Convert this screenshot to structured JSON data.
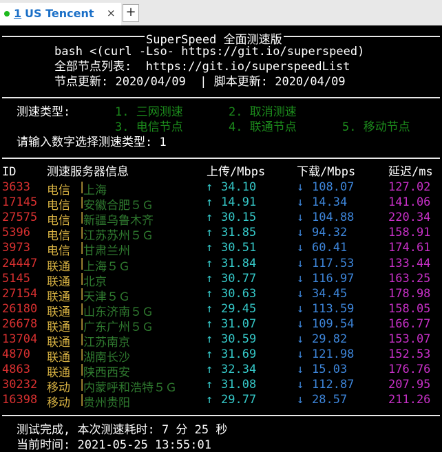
{
  "tab": {
    "number": "1",
    "title": "US Tencent",
    "close": "×",
    "new_tab": "+"
  },
  "header": {
    "title": "SuperSpeed 全面测速版",
    "line1": "bash <(curl -Lso- https://git.io/superspeed)",
    "line2": "全部节点列表:  https://git.io/superspeedList",
    "line3": "节点更新: 2020/04/09  | 脚本更新: 2020/04/09"
  },
  "menu": {
    "label": "测速类型:",
    "opt1": "1. 三网测速",
    "opt2": "2. 取消测速",
    "opt3": "3. 电信节点",
    "opt4": "4. 联通节点",
    "opt5": "5. 移动节点",
    "prompt": "请输入数字选择测速类型: 1"
  },
  "table": {
    "headers": {
      "id": "ID",
      "info": "测速服务器信息",
      "up": "上传/Mbps",
      "down": "下载/Mbps",
      "lat": "延迟/ms"
    },
    "rows": [
      {
        "id": "3633",
        "isp": "电信",
        "loc": "上海",
        "up": "34.10",
        "down": "108.07",
        "lat": "127.02"
      },
      {
        "id": "17145",
        "isp": "电信",
        "loc": "安徽合肥５Ｇ",
        "up": "14.91",
        "down": "14.34",
        "lat": "141.06"
      },
      {
        "id": "27575",
        "isp": "电信",
        "loc": "新疆乌鲁木齐",
        "up": "30.15",
        "down": "104.88",
        "lat": "220.34"
      },
      {
        "id": "5396",
        "isp": "电信",
        "loc": "江苏苏州５Ｇ",
        "up": "31.85",
        "down": "94.32",
        "lat": "158.91"
      },
      {
        "id": "3973",
        "isp": "电信",
        "loc": "甘肃兰州",
        "up": "30.51",
        "down": "60.41",
        "lat": "174.61"
      },
      {
        "id": "24447",
        "isp": "联通",
        "loc": "上海５Ｇ",
        "up": "31.84",
        "down": "117.53",
        "lat": "133.44"
      },
      {
        "id": "5145",
        "isp": "联通",
        "loc": "北京",
        "up": "30.77",
        "down": "116.97",
        "lat": "163.25"
      },
      {
        "id": "27154",
        "isp": "联通",
        "loc": "天津５Ｇ",
        "up": "30.63",
        "down": "34.45",
        "lat": "178.98"
      },
      {
        "id": "26180",
        "isp": "联通",
        "loc": "山东济南５Ｇ",
        "up": "29.45",
        "down": "113.59",
        "lat": "158.05"
      },
      {
        "id": "26678",
        "isp": "联通",
        "loc": "广东广州５Ｇ",
        "up": "31.07",
        "down": "109.54",
        "lat": "166.77"
      },
      {
        "id": "13704",
        "isp": "联通",
        "loc": "江苏南京",
        "up": "30.59",
        "down": "29.82",
        "lat": "153.07"
      },
      {
        "id": "4870",
        "isp": "联通",
        "loc": "湖南长沙",
        "up": "31.69",
        "down": "121.98",
        "lat": "152.53"
      },
      {
        "id": "4863",
        "isp": "联通",
        "loc": "陕西西安",
        "up": "32.34",
        "down": "15.03",
        "lat": "176.76"
      },
      {
        "id": "30232",
        "isp": "移动",
        "loc": "内蒙呼和浩特５Ｇ",
        "up": "31.08",
        "down": "112.87",
        "lat": "207.95"
      },
      {
        "id": "16398",
        "isp": "移动",
        "loc": "贵州贵阳",
        "up": "29.77",
        "down": "28.57",
        "lat": "211.26"
      }
    ]
  },
  "footer": {
    "line1": "测试完成, 本次测速耗时: 7 分 25 秒",
    "line2": "当前时间: 2021-05-25 13:55:01"
  }
}
